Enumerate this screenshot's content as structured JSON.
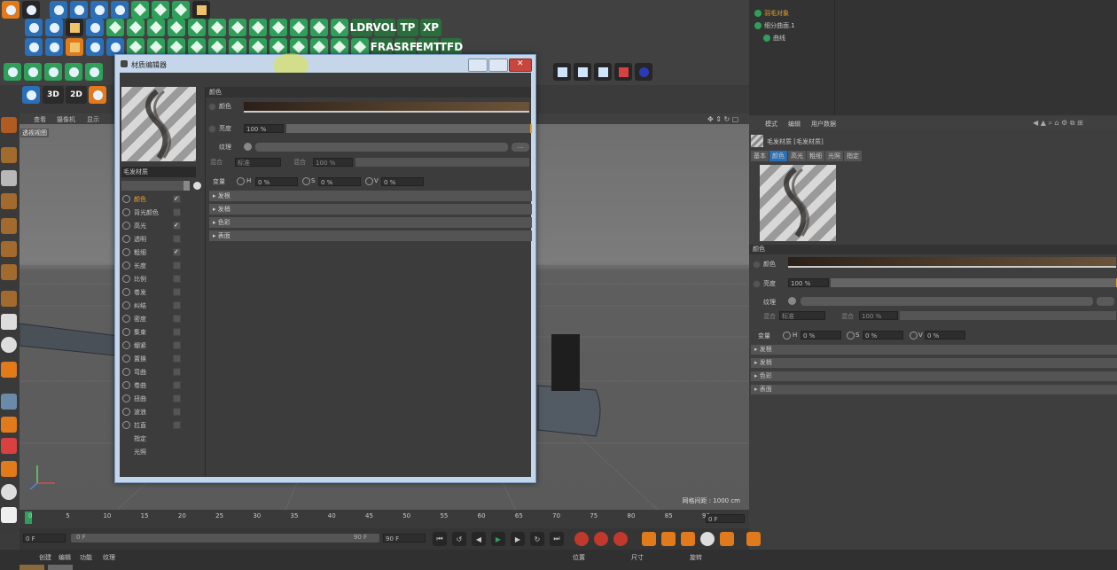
{
  "toolbar": {
    "row1": [
      "undo",
      "redo",
      "move",
      "scale",
      "rotate",
      "live-select",
      "x-axis",
      "y-axis",
      "z-axis",
      "coord-system"
    ],
    "text_buttons_row2": [
      "LDR",
      "VOL",
      "TP",
      "XP"
    ],
    "text_buttons_row3": [
      "FRA",
      "SRF",
      "EMT",
      "TFD"
    ],
    "mode_3d": "3D",
    "mode_2d": "2D"
  },
  "viewport": {
    "menu": [
      "查看",
      "摄像机",
      "显示"
    ],
    "view_name": "透视视图",
    "grid_spacing": "网格间距 : 1000 cm"
  },
  "material_editor": {
    "title": "材质编辑器",
    "material_name": "毛发材质",
    "channels": [
      {
        "label": "颜色",
        "checked": true,
        "active": true
      },
      {
        "label": "背光颜色",
        "checked": false
      },
      {
        "label": "高光",
        "checked": true
      },
      {
        "label": "透明",
        "checked": false
      },
      {
        "label": "粗细",
        "checked": true
      },
      {
        "label": "长度",
        "checked": false
      },
      {
        "label": "比例",
        "checked": false
      },
      {
        "label": "卷发",
        "checked": false
      },
      {
        "label": "纠结",
        "checked": false
      },
      {
        "label": "密度",
        "checked": false
      },
      {
        "label": "集束",
        "checked": false
      },
      {
        "label": "绷紧",
        "checked": false
      },
      {
        "label": "置换",
        "checked": false
      },
      {
        "label": "弯曲",
        "checked": false
      },
      {
        "label": "卷曲",
        "checked": false
      },
      {
        "label": "扭曲",
        "checked": false
      },
      {
        "label": "波浪",
        "checked": false
      },
      {
        "label": "拉直",
        "checked": false
      },
      {
        "label": "指定",
        "checked": null
      },
      {
        "label": "光照",
        "checked": null
      }
    ],
    "section_title": "颜色",
    "color_label": "颜色",
    "brightness_label": "亮度",
    "brightness_value": "100 %",
    "texture_label": "纹理",
    "texture_button": "...",
    "mix_mode_label": "混合",
    "mix_mode_value": "标准",
    "mix_strength_label": "混合",
    "mix_strength_value": "100 %",
    "variation_label": "变量",
    "h_label": "H",
    "h_value": "0 %",
    "s_label": "S",
    "s_value": "0 %",
    "v_label": "V",
    "v_value": "0 %",
    "subsections": [
      "发根",
      "发梢",
      "色彩",
      "表面"
    ]
  },
  "objects": {
    "items": [
      {
        "name": "羽毛对象",
        "color": "#f0a020"
      },
      {
        "name": "细分曲面.1",
        "color": "#c8c8c8"
      },
      {
        "name": "曲线",
        "color": "#c8c8c8"
      }
    ]
  },
  "attributes": {
    "menu": [
      "模式",
      "编辑",
      "用户数据"
    ],
    "header": "毛发材质 [毛发材质]",
    "tabs": [
      "基本",
      "颜色",
      "高光",
      "粗细",
      "光照",
      "指定"
    ],
    "active_tab": "颜色",
    "section_title": "颜色",
    "color_label": "颜色",
    "brightness_label": "亮度",
    "brightness_value": "100 %",
    "texture_label": "纹理",
    "mix_mode_label": "混合",
    "mix_mode_value": "标准",
    "mix_strength_label": "混合",
    "mix_strength_value": "100 %",
    "variation_label": "变量",
    "h_label": "H",
    "h_value": "0 %",
    "s_label": "S",
    "s_value": "0 %",
    "v_label": "V",
    "v_value": "0 %",
    "subsections": [
      "发根",
      "发梢",
      "色彩",
      "表面"
    ]
  },
  "timeline": {
    "ticks": [
      "0",
      "5",
      "10",
      "15",
      "20",
      "25",
      "30",
      "35",
      "40",
      "45",
      "50",
      "55",
      "60",
      "65",
      "70",
      "75",
      "80",
      "85",
      "90"
    ],
    "current_frame": "0 F",
    "start_field": "0 F",
    "range_start": "0 F",
    "range_end": "90 F",
    "end_field": "90 F"
  },
  "bottom": {
    "menu": [
      "创建",
      "编辑",
      "功能",
      "纹理"
    ],
    "coord_labels": [
      "位置",
      "尺寸",
      "旋转"
    ]
  },
  "colors": {
    "accent_green": "#2fa05a",
    "accent_orange": "#e07a1b",
    "accent_blue": "#2a6fb8",
    "active_channel": "#f0a020"
  }
}
